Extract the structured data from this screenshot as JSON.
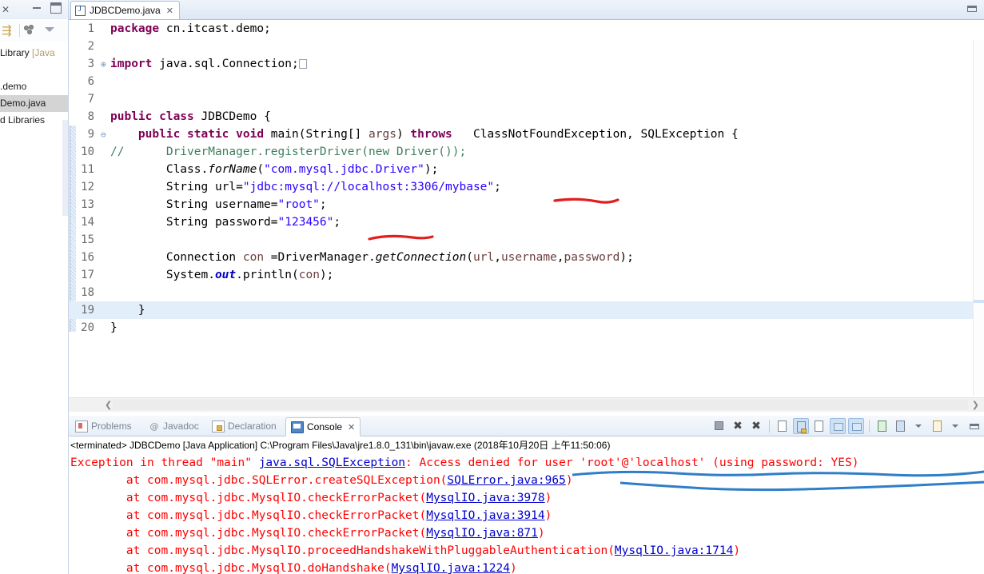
{
  "left_panel": {
    "tab_close_icon": "✕",
    "toolbar": {
      "sort_icon": "sort-icon",
      "dots_icon": "link-icon",
      "menu_caret_icon": "view-menu-icon"
    },
    "tree_items": [
      {
        "label": " Library ",
        "dim": "[Java"
      },
      {
        "label": "",
        "dim": ""
      },
      {
        "label": ".demo",
        "dim": ""
      },
      {
        "label": "Demo.java",
        "dim": "",
        "selected": true
      },
      {
        "label": "d Libraries",
        "dim": ""
      }
    ]
  },
  "editor": {
    "tab": {
      "title": "JDBCDemo.java",
      "close": "✕",
      "icon": "java-file-icon"
    },
    "restore_icon": "restore-window-icon",
    "lines": [
      {
        "no": "1",
        "ann": "",
        "html": "<span class='k'>package</span> <span class='plain'>cn.itcast.demo;</span>"
      },
      {
        "no": "2",
        "ann": "",
        "html": ""
      },
      {
        "no": "3",
        "ann": "⊕",
        "html": "<span class='k'>import</span> <span class='plain'>java.sql.Connection;</span><span class='imp-box'></span>"
      },
      {
        "no": "6",
        "ann": "",
        "html": ""
      },
      {
        "no": "7",
        "ann": "",
        "html": ""
      },
      {
        "no": "8",
        "ann": "",
        "html": "<span class='k'>public class</span> <span class='plain'>JDBCDemo {</span>"
      },
      {
        "no": "9",
        "ann": "⊖",
        "html": "    <span class='k'>public static void</span> <span class='plain'>main(String[] </span><span class='param'>args</span><span class='plain'>) </span><span class='k'>throws</span> <span class='plain'>  ClassNotFoundException, SQLException {</span>"
      },
      {
        "no": "10",
        "ann": "",
        "html": "<span class='c'>//      DriverManager.registerDriver(new Driver());</span>"
      },
      {
        "no": "11",
        "ann": "",
        "html": "        <span class='plain'>Class.</span><span class='it'>forName</span><span class='plain'>(</span><span class='s'>\"com.mysql.jdbc.Driver\"</span><span class='plain'>);</span>"
      },
      {
        "no": "12",
        "ann": "",
        "html": "        <span class='plain'>String url=</span><span class='s'>\"jdbc:mysql://localhost:3306/mybase\"</span><span class='plain'>;</span>"
      },
      {
        "no": "13",
        "ann": "",
        "html": "        <span class='plain'>String username=</span><span class='s'>\"root\"</span><span class='plain'>;</span>"
      },
      {
        "no": "14",
        "ann": "",
        "html": "        <span class='plain'>String password=</span><span class='s'>\"123456\"</span><span class='plain'>;</span>"
      },
      {
        "no": "15",
        "ann": "",
        "html": ""
      },
      {
        "no": "16",
        "ann": "",
        "html": "        <span class='plain'>Connection </span><span class='param'>con</span><span class='plain'> =DriverManager.</span><span class='it'>getConnection</span><span class='plain'>(</span><span class='param'>url</span><span class='plain'>,</span><span class='param'>username</span><span class='plain'>,</span><span class='param'>password</span><span class='plain'>);</span>"
      },
      {
        "no": "17",
        "ann": "",
        "html": "        <span class='plain'>System.</span><span class='itb'>out</span><span class='plain'>.println(</span><span class='param'>con</span><span class='plain'>);</span>",
        "highlight": true
      },
      {
        "no": "18",
        "ann": "",
        "html": ""
      },
      {
        "no": "19",
        "ann": "",
        "html": "    <span class='plain'>}</span>"
      },
      {
        "no": "20",
        "ann": "",
        "html": "<span class='plain'>}</span>"
      }
    ],
    "hscroll": {
      "left_arrow": "❮",
      "right_arrow": "❯"
    }
  },
  "console": {
    "tabs": [
      {
        "label": "Problems",
        "icon": "problems-icon",
        "active": false
      },
      {
        "label": "Javadoc",
        "icon": "javadoc-icon",
        "active": false
      },
      {
        "label": "Declaration",
        "icon": "declaration-icon",
        "active": false
      },
      {
        "label": "Console",
        "icon": "console-icon",
        "active": true,
        "close": "✕"
      }
    ],
    "toolbar_buttons": [
      {
        "name": "terminate-button",
        "state": "off"
      },
      {
        "name": "remove-launch-button",
        "state": "off"
      },
      {
        "name": "remove-all-terminated-button",
        "state": "off"
      },
      {
        "name": "clear-console-button",
        "state": "off"
      },
      {
        "name": "scroll-lock-button",
        "state": "on"
      },
      {
        "name": "word-wrap-button",
        "state": "off"
      },
      {
        "name": "show-console-on-output-button",
        "state": "on"
      },
      {
        "name": "show-console-on-error-button",
        "state": "on"
      },
      {
        "name": "pin-console-button",
        "state": "off"
      },
      {
        "name": "display-selected-console-button",
        "state": "off"
      },
      {
        "name": "display-selected-console-dropdown",
        "state": "off"
      },
      {
        "name": "open-console-button",
        "state": "off"
      },
      {
        "name": "open-console-dropdown",
        "state": "off"
      },
      {
        "name": "minimize-button",
        "state": "off"
      }
    ],
    "launch_line": "<terminated> JDBCDemo [Java Application] C:\\Program Files\\Java\\jre1.8.0_131\\bin\\javaw.exe (2018年10月20日 上午11:50:06)",
    "output_lines": [
      {
        "text": "Exception in thread \"main\" ",
        "link": "java.sql.SQLException",
        "after": ": Access denied for user 'root'@'localhost' (using password: YES)"
      },
      {
        "text": "        at com.mysql.jdbc.SQLError.createSQLException(",
        "link": "SQLError.java:965",
        "after": ")"
      },
      {
        "text": "        at com.mysql.jdbc.MysqlIO.checkErrorPacket(",
        "link": "MysqlIO.java:3978",
        "after": ")"
      },
      {
        "text": "        at com.mysql.jdbc.MysqlIO.checkErrorPacket(",
        "link": "MysqlIO.java:3914",
        "after": ")"
      },
      {
        "text": "        at com.mysql.jdbc.MysqlIO.checkErrorPacket(",
        "link": "MysqlIO.java:871",
        "after": ")"
      },
      {
        "text": "        at com.mysql.jdbc.MysqlIO.proceedHandshakeWithPluggableAuthentication(",
        "link": "MysqlIO.java:1714",
        "after": ")"
      },
      {
        "text": "        at com.mysql.jdbc.MysqlIO.doHandshake(",
        "link": "MysqlIO.java:1224",
        "after": ")"
      }
    ]
  },
  "annotations": {
    "red_color": "#e02020",
    "blue_color": "#2f7ec8",
    "red_marks": [
      "underline-mybase",
      "underline-123456"
    ],
    "blue_marks": [
      "underline-access-denied",
      "underline-sqlerror-line"
    ]
  }
}
